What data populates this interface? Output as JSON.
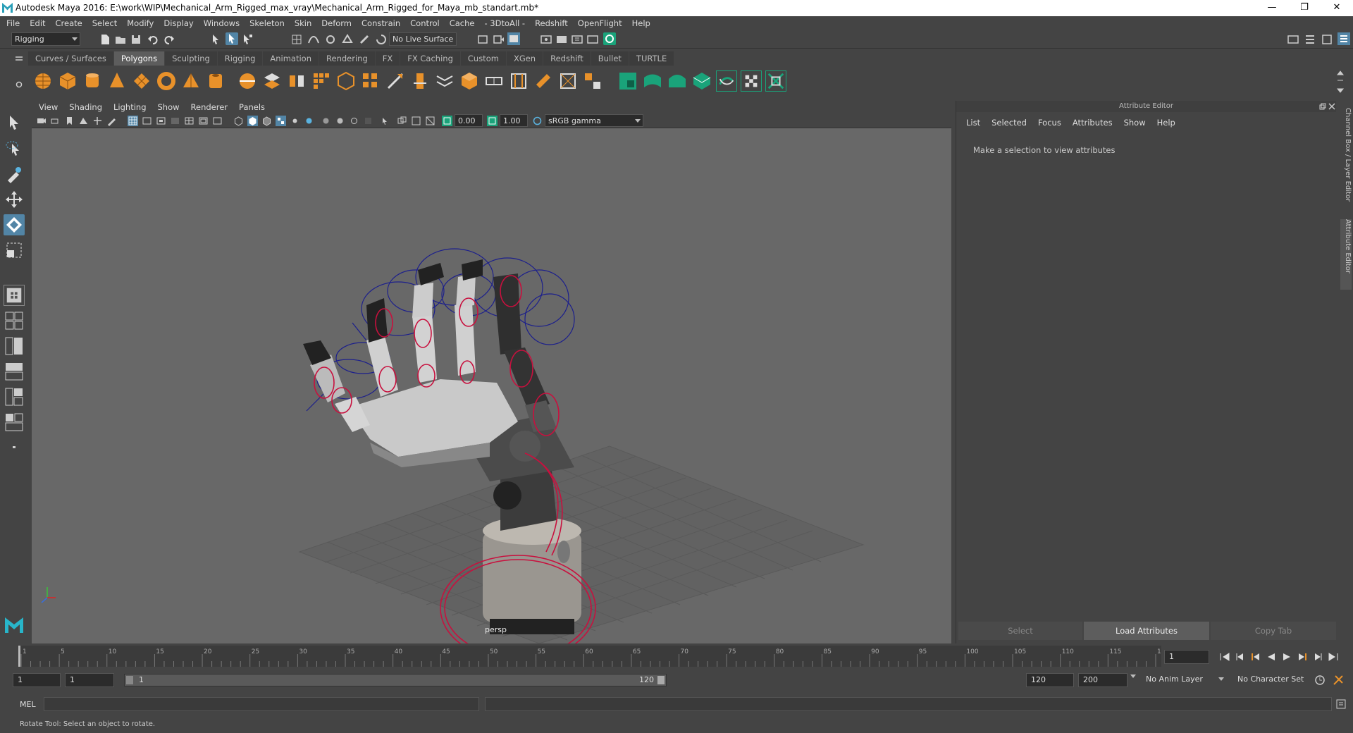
{
  "window": {
    "title": "Autodesk Maya 2016: E:\\work\\WIP\\Mechanical_Arm_Rigged_max_vray\\Mechanical_Arm_Rigged_for_Maya_mb_standart.mb*",
    "minimize": "—",
    "maximize": "❐",
    "close": "✕"
  },
  "menus": [
    "File",
    "Edit",
    "Create",
    "Select",
    "Modify",
    "Display",
    "Windows",
    "Skeleton",
    "Skin",
    "Deform",
    "Constrain",
    "Control",
    "Cache",
    "- 3DtoAll -",
    "Redshift",
    "OpenFlight",
    "Help"
  ],
  "status_line": {
    "menu_set": "Rigging",
    "live_surface": "No Live Surface"
  },
  "shelf": {
    "tabs": [
      "Curves / Surfaces",
      "Polygons",
      "Sculpting",
      "Rigging",
      "Animation",
      "Rendering",
      "FX",
      "FX Caching",
      "Custom",
      "XGen",
      "Redshift",
      "Bullet",
      "TURTLE"
    ],
    "active_tab": "Polygons"
  },
  "viewport": {
    "menus": [
      "View",
      "Shading",
      "Lighting",
      "Show",
      "Renderer",
      "Panels"
    ],
    "exposure": "0.00",
    "gamma": "1.00",
    "color_space": "sRGB gamma",
    "camera_label": "persp"
  },
  "attribute_editor": {
    "title": "Attribute Editor",
    "menus": [
      "List",
      "Selected",
      "Focus",
      "Attributes",
      "Show",
      "Help"
    ],
    "message": "Make a selection to view attributes",
    "buttons": {
      "select": "Select",
      "load": "Load Attributes",
      "copy_tab": "Copy Tab"
    }
  },
  "side_tabs": {
    "channel_box": "Channel Box / Layer Editor",
    "attribute_editor": "Attribute Editor"
  },
  "time_slider": {
    "ticks": [
      "1",
      "5",
      "10",
      "15",
      "20",
      "25",
      "30",
      "35",
      "40",
      "45",
      "50",
      "55",
      "60",
      "65",
      "70",
      "75",
      "80",
      "85",
      "90",
      "95",
      "100",
      "105",
      "110",
      "115",
      "120"
    ],
    "current_frame": "1"
  },
  "range_slider": {
    "start_time": "1",
    "playback_start": "1",
    "range_start_label": "1",
    "range_end_label": "120",
    "playback_end": "120",
    "end_time": "200",
    "anim_layer": "No Anim Layer",
    "character_set": "No Character Set"
  },
  "command_line": {
    "label": "MEL"
  },
  "help_line": {
    "text": "Rotate Tool: Select an object to rotate."
  },
  "colors": {
    "ui_bg": "#444444",
    "viewport_bg": "#686868",
    "highlight": "#5285a6",
    "control_red": "#c8103e",
    "control_blue": "#1c1f8c",
    "shelf_green": "#1aa37a",
    "shelf_orange": "#e8912a"
  }
}
